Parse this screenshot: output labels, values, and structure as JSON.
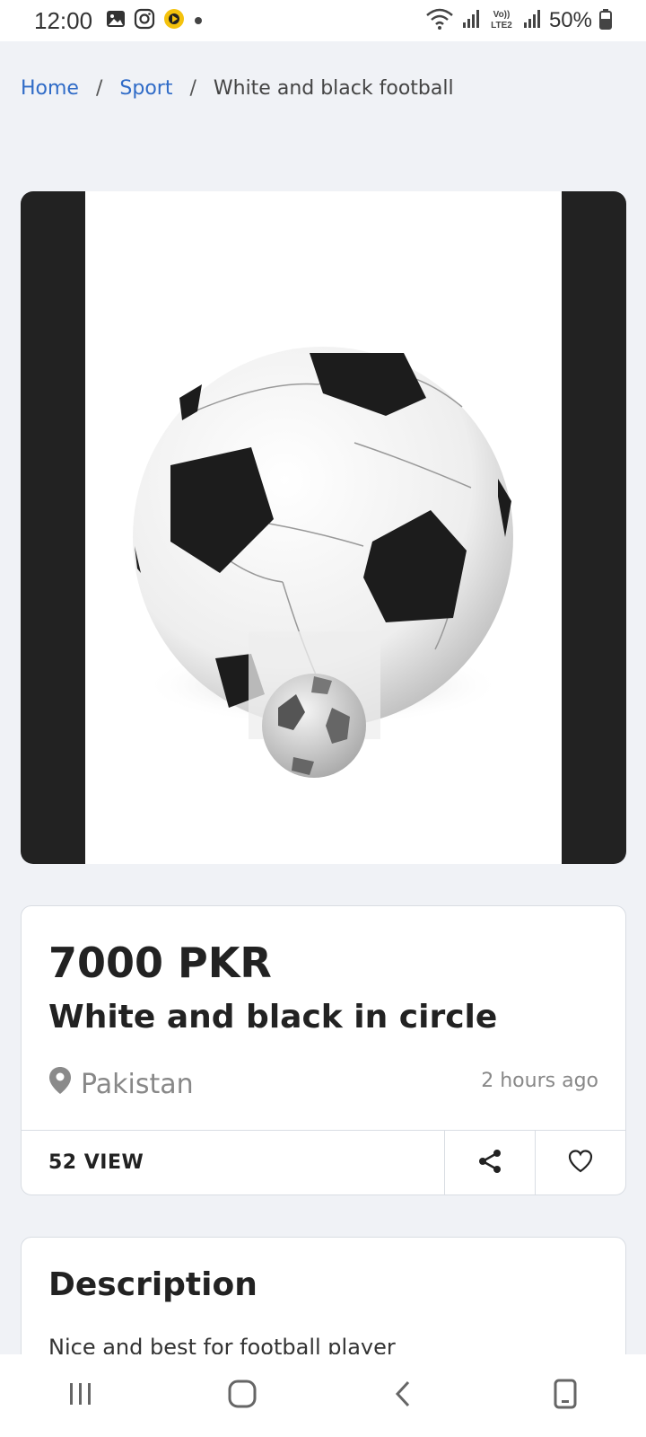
{
  "status_bar": {
    "time": "12:00",
    "battery": "50%",
    "icons_left": [
      "gallery-icon",
      "instagram-icon",
      "app-icon",
      "dot-icon"
    ],
    "icons_right": [
      "wifi-icon",
      "signal-icon",
      "volte-icon",
      "signal-icon",
      "battery-icon"
    ]
  },
  "breadcrumb": {
    "home": "Home",
    "category": "Sport",
    "current": "White and black football"
  },
  "product": {
    "price": "7000 PKR",
    "title": "White and black in circle",
    "location": "Pakistan",
    "posted": "2 hours ago",
    "views": "52 VIEW"
  },
  "description": {
    "heading": "Description",
    "text": "Nice and best for football player"
  },
  "nav": {
    "buttons": [
      "recents-icon",
      "home-icon",
      "back-icon",
      "keyboard-icon"
    ]
  }
}
